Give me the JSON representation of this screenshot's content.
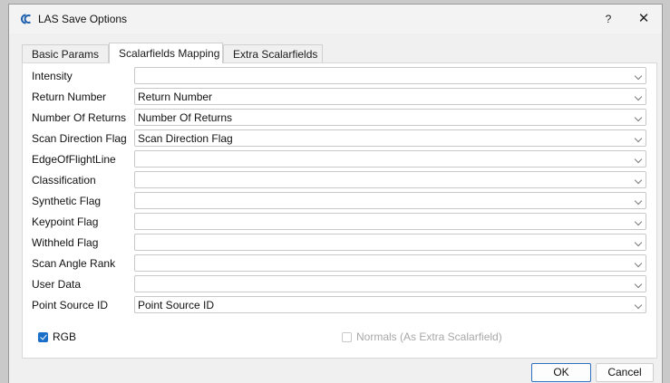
{
  "window": {
    "title": "LAS Save Options",
    "help_label": "?",
    "close_label": "✕"
  },
  "tabs": [
    {
      "label": "Basic Params",
      "active": false
    },
    {
      "label": "Scalarfields Mapping",
      "active": true
    },
    {
      "label": "Extra Scalarfields",
      "active": false
    }
  ],
  "fields": [
    {
      "label": "Intensity",
      "value": ""
    },
    {
      "label": "Return Number",
      "value": "Return Number"
    },
    {
      "label": "Number Of Returns",
      "value": "Number Of Returns"
    },
    {
      "label": "Scan Direction Flag",
      "value": "Scan Direction Flag"
    },
    {
      "label": "EdgeOfFlightLine",
      "value": ""
    },
    {
      "label": "Classification",
      "value": ""
    },
    {
      "label": "Synthetic Flag",
      "value": ""
    },
    {
      "label": "Keypoint Flag",
      "value": ""
    },
    {
      "label": "Withheld Flag",
      "value": ""
    },
    {
      "label": "Scan Angle Rank",
      "value": ""
    },
    {
      "label": "User Data",
      "value": ""
    },
    {
      "label": "Point Source ID",
      "value": "Point Source ID"
    }
  ],
  "options": {
    "rgb": {
      "label": "RGB",
      "checked": true
    },
    "normals": {
      "label": "Normals (As Extra Scalarfield)",
      "checked": false,
      "enabled": false
    }
  },
  "buttons": {
    "ok": "OK",
    "cancel": "Cancel"
  },
  "colors": {
    "accent": "#1a6fc9",
    "window_bg": "#f0f0f0",
    "panel_bg": "#ffffff"
  }
}
